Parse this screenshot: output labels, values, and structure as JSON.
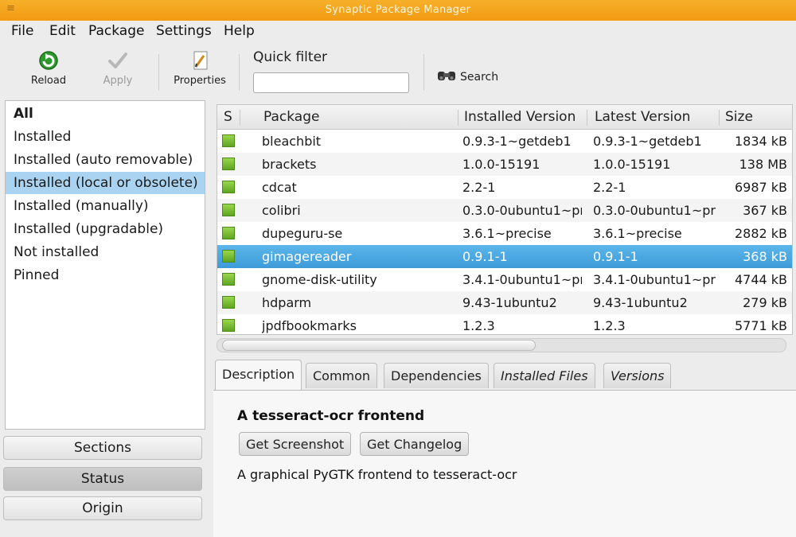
{
  "window": {
    "title": "Synaptic Package Manager",
    "grip": "≡"
  },
  "menubar": [
    {
      "label": "File"
    },
    {
      "label": "Edit"
    },
    {
      "label": "Package"
    },
    {
      "label": "Settings"
    },
    {
      "label": "Help"
    }
  ],
  "toolbar": {
    "reload": "Reload",
    "apply": "Apply",
    "properties": "Properties",
    "quick_filter_label": "Quick filter",
    "quick_filter_value": "",
    "search": "Search"
  },
  "filters": {
    "items": [
      "All",
      "Installed",
      "Installed (auto removable)",
      "Installed (local or obsolete)",
      "Installed (manually)",
      "Installed (upgradable)",
      "Not installed",
      "Pinned"
    ],
    "selected": "Installed (local or obsolete)"
  },
  "side_buttons": {
    "sections": "Sections",
    "status": "Status",
    "origin": "Origin"
  },
  "table": {
    "headers": {
      "s": "S",
      "package": "Package",
      "installed": "Installed Version",
      "latest": "Latest Version",
      "size": "Size"
    },
    "rows": [
      {
        "package": "bleachbit",
        "installed": "0.9.3-1~getdeb1",
        "latest": "0.9.3-1~getdeb1",
        "size": "1834 kB"
      },
      {
        "package": "brackets",
        "installed": "1.0.0-15191",
        "latest": "1.0.0-15191",
        "size": "138 MB"
      },
      {
        "package": "cdcat",
        "installed": "2.2-1",
        "latest": "2.2-1",
        "size": "6987 kB"
      },
      {
        "package": "colibri",
        "installed": "0.3.0-0ubuntu1~pr",
        "latest": "0.3.0-0ubuntu1~pr",
        "size": "367 kB"
      },
      {
        "package": "dupeguru-se",
        "installed": "3.6.1~precise",
        "latest": "3.6.1~precise",
        "size": "2882 kB"
      },
      {
        "package": "gimagereader",
        "installed": "0.9.1-1",
        "latest": "0.9.1-1",
        "size": "368 kB"
      },
      {
        "package": "gnome-disk-utility",
        "installed": "3.4.1-0ubuntu1~pr",
        "latest": "3.4.1-0ubuntu1~pr",
        "size": "4744 kB"
      },
      {
        "package": "hdparm",
        "installed": "9.43-1ubuntu2",
        "latest": "9.43-1ubuntu2",
        "size": "279 kB"
      },
      {
        "package": "jpdfbookmarks",
        "installed": "1.2.3",
        "latest": "1.2.3",
        "size": "5771 kB"
      }
    ],
    "selected_row": "gimagereader",
    "status_color": "#7cc23a",
    "selection_color": "#4aa7e0"
  },
  "tabs": [
    "Description",
    "Common",
    "Dependencies",
    "Installed Files",
    "Versions"
  ],
  "active_tab": "Description",
  "details": {
    "heading": "A tesseract-ocr frontend",
    "screenshot_button": "Get Screenshot",
    "changelog_button": "Get Changelog",
    "description": "A graphical PyGTK frontend to tesseract-ocr"
  }
}
